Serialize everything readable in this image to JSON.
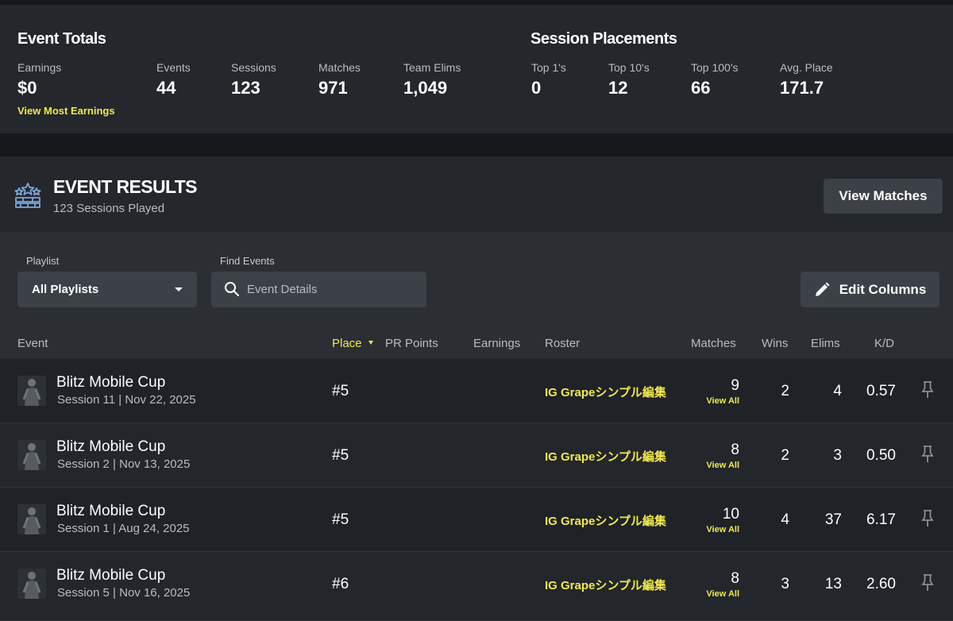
{
  "event_totals": {
    "title": "Event Totals",
    "stats": [
      {
        "label": "Earnings",
        "value": "$0"
      },
      {
        "label": "Events",
        "value": "44"
      },
      {
        "label": "Sessions",
        "value": "123"
      },
      {
        "label": "Matches",
        "value": "971"
      },
      {
        "label": "Team Elims",
        "value": "1,049"
      }
    ],
    "link": "View Most Earnings"
  },
  "session_placements": {
    "title": "Session Placements",
    "stats": [
      {
        "label": "Top 1's",
        "value": "0"
      },
      {
        "label": "Top 10's",
        "value": "12"
      },
      {
        "label": "Top 100's",
        "value": "66"
      },
      {
        "label": "Avg. Place",
        "value": "171.7"
      }
    ]
  },
  "results": {
    "title": "EVENT RESULTS",
    "subtitle": "123 Sessions Played",
    "view_matches": "View Matches"
  },
  "filters": {
    "playlist_label": "Playlist",
    "playlist_value": "All Playlists",
    "find_label": "Find Events",
    "search_placeholder": "Event Details",
    "edit_columns": "Edit Columns"
  },
  "columns": {
    "event": "Event",
    "place": "Place",
    "pr_points": "PR Points",
    "earnings": "Earnings",
    "roster": "Roster",
    "matches": "Matches",
    "wins": "Wins",
    "elims": "Elims",
    "kd": "K/D"
  },
  "rows": [
    {
      "name": "Blitz Mobile Cup",
      "session": "Session 11 | Nov 22, 2025",
      "place": "#5",
      "roster": "IG Grapeシンプル編集",
      "matches": "9",
      "view_all": "View All",
      "wins": "2",
      "elims": "4",
      "kd": "0.57"
    },
    {
      "name": "Blitz Mobile Cup",
      "session": "Session 2 | Nov 13, 2025",
      "place": "#5",
      "roster": "IG Grapeシンプル編集",
      "matches": "8",
      "view_all": "View All",
      "wins": "2",
      "elims": "3",
      "kd": "0.50"
    },
    {
      "name": "Blitz Mobile Cup",
      "session": "Session 1 | Aug 24, 2025",
      "place": "#5",
      "roster": "IG Grapeシンプル編集",
      "matches": "10",
      "view_all": "View All",
      "wins": "4",
      "elims": "37",
      "kd": "6.17"
    },
    {
      "name": "Blitz Mobile Cup",
      "session": "Session 5 | Nov 16, 2025",
      "place": "#6",
      "roster": "IG Grapeシンプル編集",
      "matches": "8",
      "view_all": "View All",
      "wins": "3",
      "elims": "13",
      "kd": "2.60"
    }
  ],
  "colors": {
    "accent": "#f2e94e",
    "panel": "#24272b",
    "button": "#3c4047"
  },
  "icons": [
    "trophy-stars-icon",
    "chevron-down-icon",
    "search-icon",
    "pencil-icon",
    "pin-icon",
    "player-skin-icon"
  ]
}
